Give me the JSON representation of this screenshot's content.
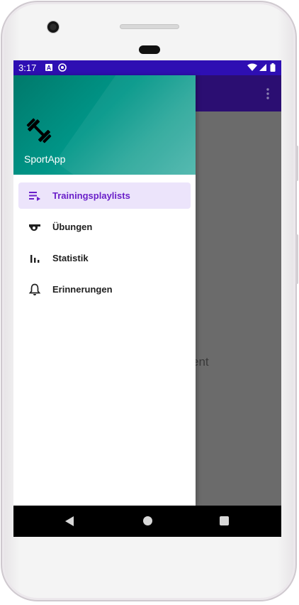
{
  "status_bar": {
    "time": "3:17",
    "icons": [
      "text-notification-icon",
      "sync-notification-icon",
      "wifi-icon",
      "cell-signal-icon",
      "battery-icon"
    ],
    "color": "#2e0fb3"
  },
  "app": {
    "name": "SportApp",
    "logo_icon": "dumbbell-icon",
    "background_text": "ent",
    "toolbar_icon": "overflow-menu-icon",
    "accent_color": "#6a1fc9",
    "header_color": "#009688"
  },
  "drawer": {
    "items": [
      {
        "label": "Trainingsplaylists",
        "icon": "playlist-icon",
        "active": true
      },
      {
        "label": "Übungen",
        "icon": "whistle-icon",
        "active": false
      },
      {
        "label": "Statistik",
        "icon": "bar-chart-icon",
        "active": false
      },
      {
        "label": "Erinnerungen",
        "icon": "bell-icon",
        "active": false
      }
    ]
  },
  "system_nav": {
    "icons": [
      "back-icon",
      "home-icon",
      "recents-icon"
    ]
  }
}
